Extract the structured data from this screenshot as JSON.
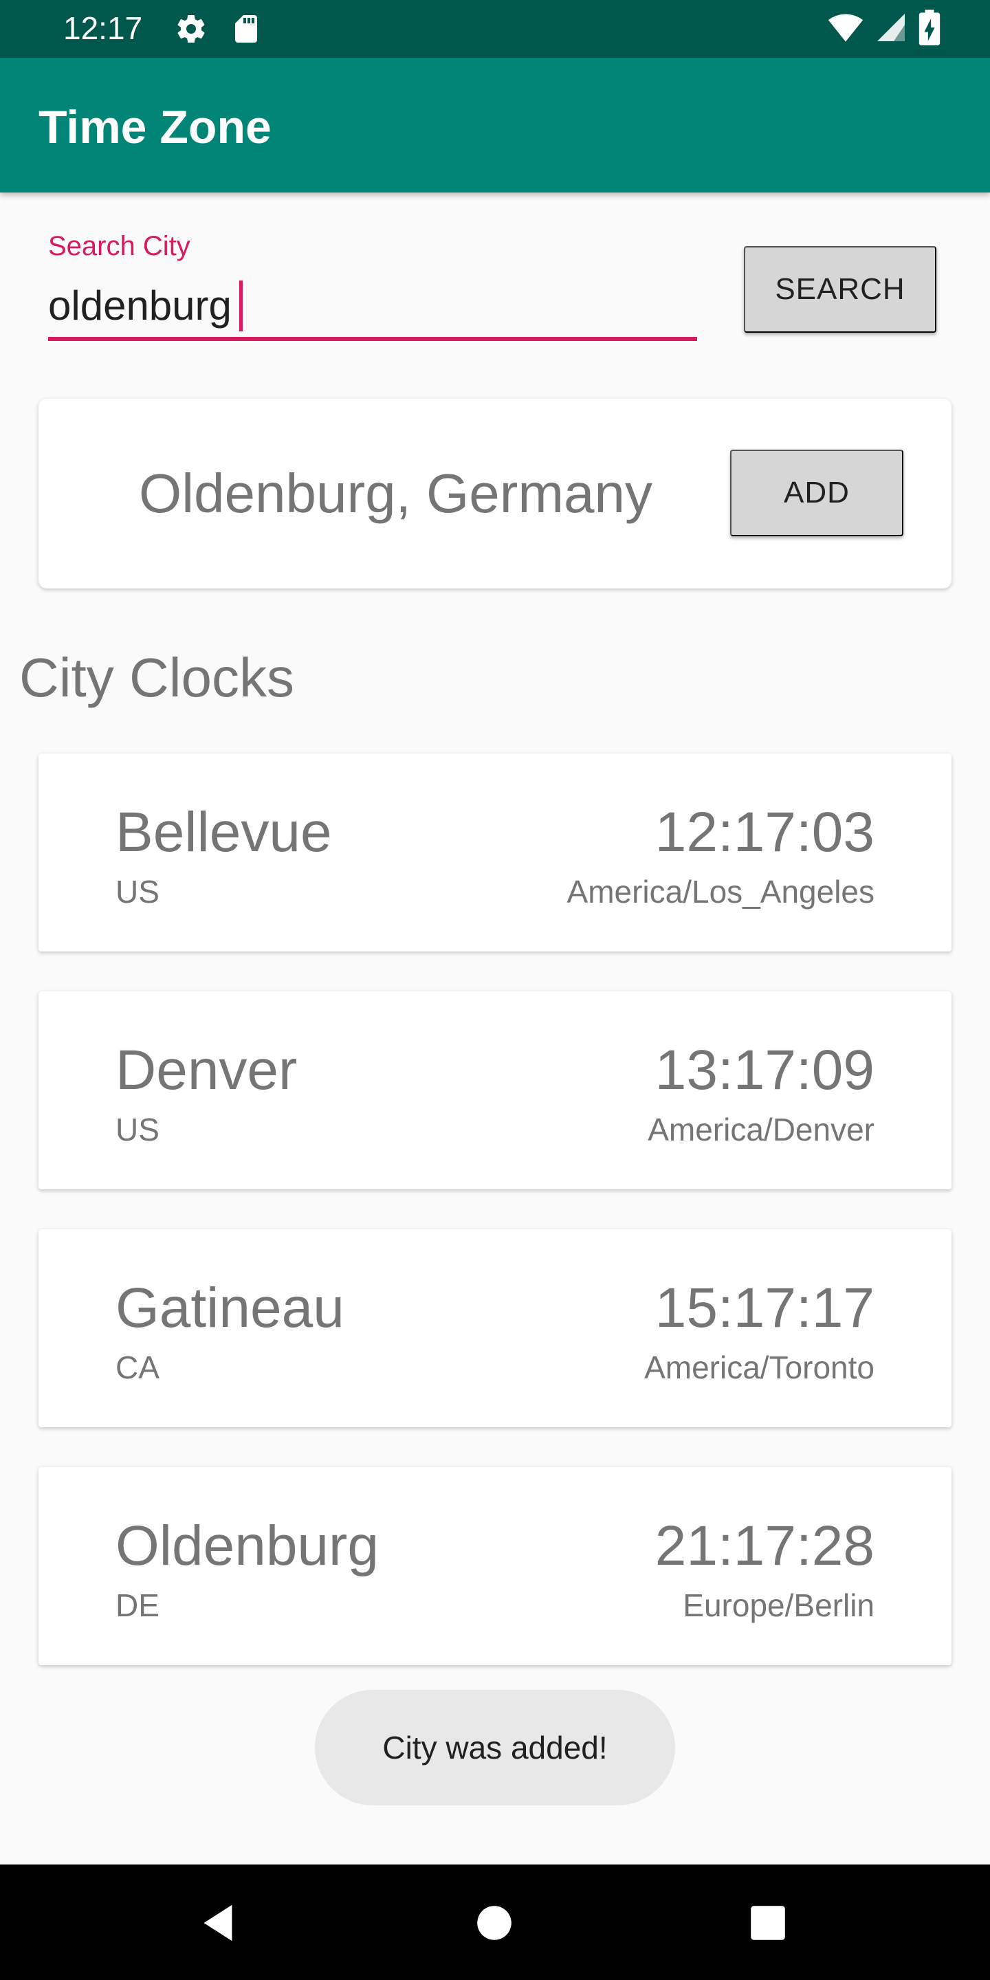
{
  "status_bar": {
    "time": "12:17",
    "icons": [
      "gear-icon",
      "sd-card-icon",
      "wifi-icon",
      "signal-icon",
      "battery-charging-icon"
    ]
  },
  "app_bar": {
    "title": "Time Zone"
  },
  "search": {
    "label": "Search City",
    "value": "oldenburg",
    "button_label": "SEARCH"
  },
  "result": {
    "city_name": "Oldenburg, Germany",
    "add_label": "ADD"
  },
  "section_title": "City Clocks",
  "clocks": [
    {
      "city": "Bellevue",
      "country": "US",
      "time": "12:17:03",
      "zone": "America/Los_Angeles"
    },
    {
      "city": "Denver",
      "country": "US",
      "time": "13:17:09",
      "zone": "America/Denver"
    },
    {
      "city": "Gatineau",
      "country": "CA",
      "time": "15:17:17",
      "zone": "America/Toronto"
    },
    {
      "city": "Oldenburg",
      "country": "DE",
      "time": "21:17:28",
      "zone": "Europe/Berlin"
    }
  ],
  "toast": "City was added!",
  "nav_bar": {
    "icons": [
      "back-icon",
      "home-icon",
      "recents-icon"
    ]
  },
  "colors": {
    "primary": "#008577",
    "primary_dark": "#00574b",
    "accent": "#d81b60"
  }
}
